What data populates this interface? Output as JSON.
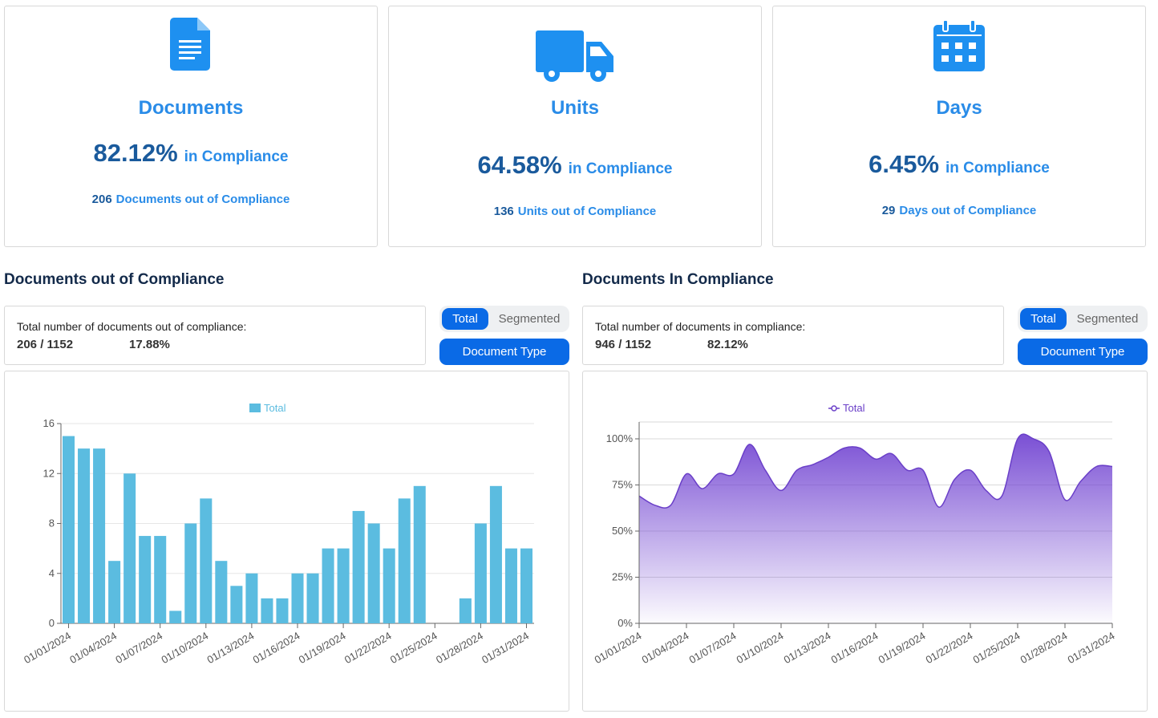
{
  "cards": [
    {
      "icon": "document-icon",
      "title": "Documents",
      "percent": "82.12%",
      "suffix": "in Compliance",
      "out_count": "206",
      "out_text": "Documents out of Compliance"
    },
    {
      "icon": "truck-icon",
      "title": "Units",
      "percent": "64.58%",
      "suffix": "in Compliance",
      "out_count": "136",
      "out_text": "Units out of Compliance"
    },
    {
      "icon": "calendar-icon",
      "title": "Days",
      "percent": "6.45%",
      "suffix": "in Compliance",
      "out_count": "29",
      "out_text": "Days out of Compliance"
    }
  ],
  "left_panel": {
    "title": "Documents out of Compliance",
    "summary_label": "Total number of documents out of compliance:",
    "ratio": "206 / 1152",
    "percent": "17.88%",
    "toggle": {
      "total": "Total",
      "segmented": "Segmented"
    },
    "type_button": "Document Type"
  },
  "right_panel": {
    "title": "Documents In Compliance",
    "summary_label": "Total number of documents in compliance:",
    "ratio": "946 / 1152",
    "percent": "82.12%",
    "toggle": {
      "total": "Total",
      "segmented": "Segmented"
    },
    "type_button": "Document Type"
  },
  "colors": {
    "accent": "#0a6ae6",
    "card_blue": "#2a8ce8",
    "dark_blue": "#1a5a9c",
    "bar": "#5bbce0",
    "area": "#7c4fd6"
  },
  "chart_data": [
    {
      "type": "bar",
      "legend": "Total",
      "legend_position": "top-center",
      "x": [
        "01/01/2024",
        "01/02/2024",
        "01/03/2024",
        "01/04/2024",
        "01/05/2024",
        "01/06/2024",
        "01/07/2024",
        "01/08/2024",
        "01/09/2024",
        "01/10/2024",
        "01/11/2024",
        "01/12/2024",
        "01/13/2024",
        "01/14/2024",
        "01/15/2024",
        "01/16/2024",
        "01/17/2024",
        "01/18/2024",
        "01/19/2024",
        "01/20/2024",
        "01/21/2024",
        "01/22/2024",
        "01/23/2024",
        "01/24/2024",
        "01/25/2024",
        "01/26/2024",
        "01/27/2024",
        "01/28/2024",
        "01/29/2024",
        "01/30/2024",
        "01/31/2024"
      ],
      "x_tick_labels": [
        "01/01/2024",
        "01/04/2024",
        "01/07/2024",
        "01/10/2024",
        "01/13/2024",
        "01/16/2024",
        "01/19/2024",
        "01/22/2024",
        "01/25/2024",
        "01/28/2024",
        "01/31/2024"
      ],
      "values": [
        15,
        14,
        14,
        5,
        12,
        7,
        7,
        1,
        8,
        10,
        5,
        3,
        4,
        2,
        2,
        4,
        4,
        6,
        6,
        9,
        8,
        6,
        10,
        11,
        0,
        0,
        2,
        8,
        11,
        6,
        6
      ],
      "ylim": [
        0,
        16
      ],
      "y_ticks": [
        0,
        4,
        8,
        12,
        16
      ],
      "grid": true
    },
    {
      "type": "area",
      "legend": "Total",
      "legend_position": "top-center",
      "x": [
        "01/01/2024",
        "01/02/2024",
        "01/03/2024",
        "01/04/2024",
        "01/05/2024",
        "01/06/2024",
        "01/07/2024",
        "01/08/2024",
        "01/09/2024",
        "01/10/2024",
        "01/11/2024",
        "01/12/2024",
        "01/13/2024",
        "01/14/2024",
        "01/15/2024",
        "01/16/2024",
        "01/17/2024",
        "01/18/2024",
        "01/19/2024",
        "01/20/2024",
        "01/21/2024",
        "01/22/2024",
        "01/23/2024",
        "01/24/2024",
        "01/25/2024",
        "01/26/2024",
        "01/27/2024",
        "01/28/2024",
        "01/29/2024",
        "01/30/2024",
        "01/31/2024"
      ],
      "x_tick_labels": [
        "01/01/2024",
        "01/04/2024",
        "01/07/2024",
        "01/10/2024",
        "01/13/2024",
        "01/16/2024",
        "01/19/2024",
        "01/22/2024",
        "01/25/2024",
        "01/28/2024",
        "01/31/2024"
      ],
      "values": [
        69,
        64,
        64,
        81,
        73,
        81,
        81,
        97,
        83,
        72,
        83,
        86,
        90,
        95,
        95,
        89,
        92,
        83,
        83,
        63,
        78,
        83,
        72,
        69,
        100,
        100,
        93,
        67,
        77,
        85,
        85
      ],
      "ylim": [
        0,
        100
      ],
      "y_tick_labels": [
        "0%",
        "25%",
        "50%",
        "75%",
        "100%"
      ],
      "grid": true
    }
  ]
}
